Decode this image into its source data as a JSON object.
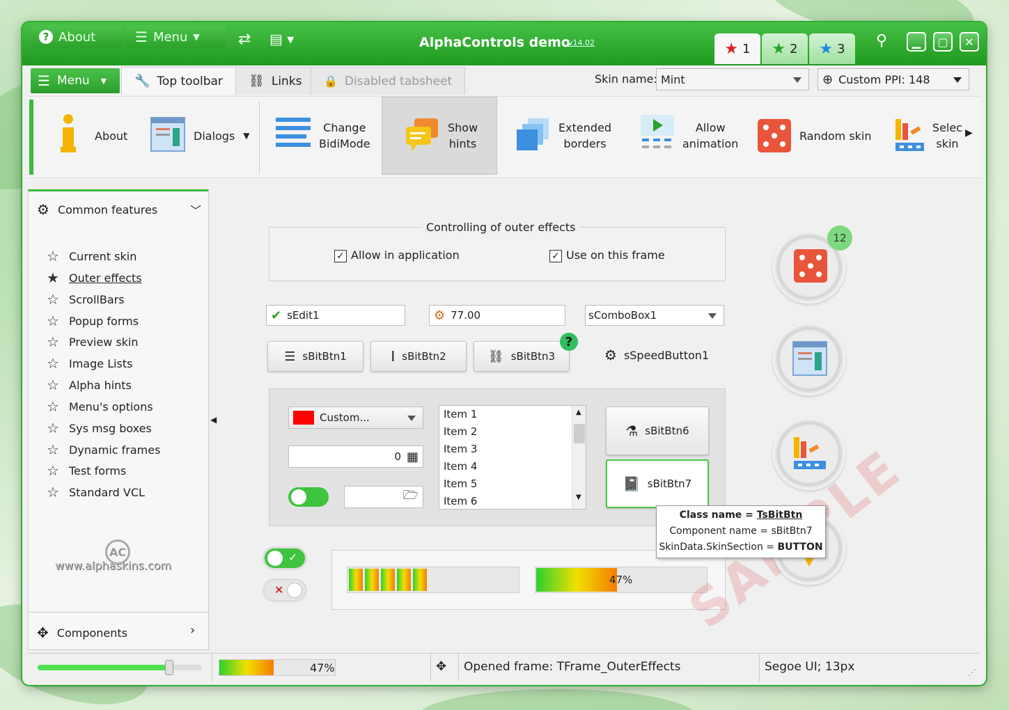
{
  "titlebar": {
    "about_label": "About",
    "menu_label": "Menu",
    "app_title": "AlphaControls demo",
    "version": "v14.02",
    "skin_tabs": [
      {
        "label": "1",
        "star_color": "#e02020"
      },
      {
        "label": "2",
        "star_color": "#2aa22a"
      },
      {
        "label": "3",
        "star_color": "#1e88e5"
      }
    ]
  },
  "tabs": {
    "menu_label": "Menu",
    "items": [
      {
        "label": "Top toolbar",
        "icon": "wrench-icon"
      },
      {
        "label": "Links",
        "icon": "link-icon"
      },
      {
        "label": "Disabled tabsheet",
        "icon": "lock-icon"
      }
    ],
    "skin_name_label": "Skin name:",
    "skin_name_value": "Mint",
    "ppi_label": "Custom PPI: 148"
  },
  "toolbar": {
    "about": "About",
    "dialogs": "Dialogs",
    "change_bidi": [
      "Change",
      "BidiMode"
    ],
    "show_hints": [
      "Show",
      "hints"
    ],
    "extended_borders": [
      "Extended",
      "borders"
    ],
    "allow_animation": [
      "Allow",
      "animation"
    ],
    "random_skin": "Random skin",
    "select_skin": [
      "Selec",
      "skin"
    ]
  },
  "sidebar": {
    "header": "Common features",
    "items": [
      "Current skin",
      "Outer effects",
      "ScrollBars",
      "Popup forms",
      "Preview skin",
      "Image Lists",
      "Alpha hints",
      "Menu's options",
      "Sys msg boxes",
      "Dynamic frames",
      "Test forms",
      "Standard VCL"
    ],
    "selected_index": 1,
    "logo_text": "www.alphaskins.com",
    "footer": "Components"
  },
  "outer": {
    "group_title": "Controlling of outer effects",
    "allow_app": "Allow in application",
    "use_frame": "Use on this frame"
  },
  "edits": {
    "sedit": "sEdit1",
    "spin": "77.00",
    "combo": "sComboBox1"
  },
  "buttons": {
    "b1": "sBitBtn1",
    "b2": "sBitBtn2",
    "b3": "sBitBtn3",
    "speed": "sSpeedButton1",
    "b6": "sBitBtn6",
    "b7": "sBitBtn7"
  },
  "panel": {
    "color_combo": "Custom...",
    "color_swatch": "#ff0000",
    "calc_value": "0",
    "list": [
      "Item 1",
      "Item 2",
      "Item 3",
      "Item 4",
      "Item 5",
      "Item 6"
    ]
  },
  "hint": {
    "line1_key": "Class name = ",
    "line1_val": "TsBitBtn",
    "line2": "Component name = sBitBtn7",
    "line3_key": "SkinData.SkinSection = ",
    "line3_val": "BUTTON"
  },
  "progress": {
    "right_bar_text": "47%",
    "right_bar_value": 0.47,
    "left_segments": 5
  },
  "badge": "12",
  "watermark": "SAMPLE",
  "status": {
    "progress_text": "47%",
    "progress_value": 0.47,
    "slider_value": 0.8,
    "frame_text": "Opened frame: TFrame_OuterEffects",
    "font_text": "Segoe UI; 13px"
  }
}
